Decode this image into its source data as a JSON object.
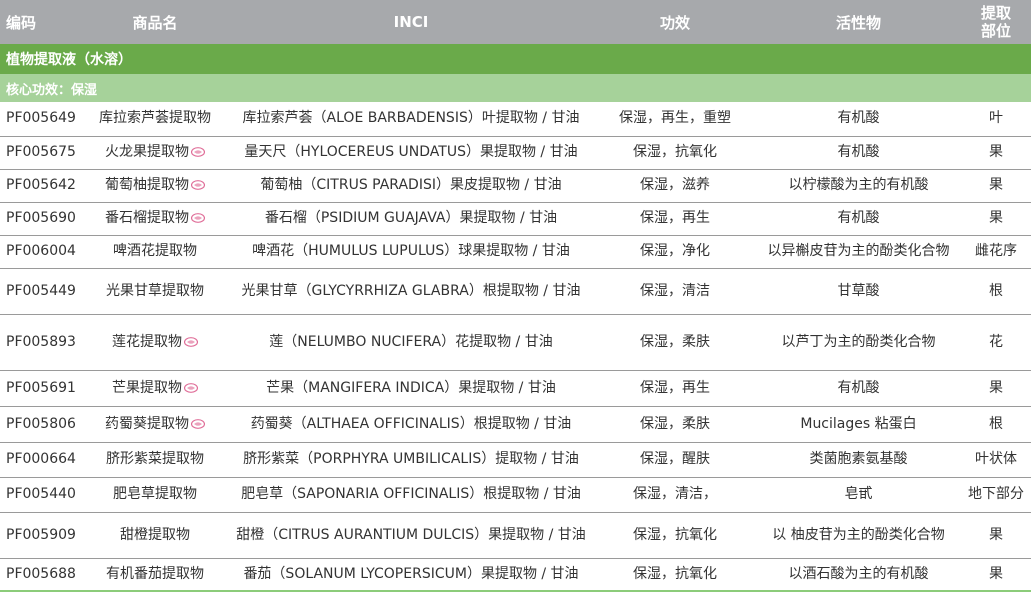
{
  "table": {
    "headers": [
      "编码",
      "商品名",
      "INCI",
      "功效",
      "活性物",
      "提取\n部位"
    ],
    "group_title": "植物提取液（水溶）",
    "subgroup_title": "核心功效：保湿",
    "rows": [
      {
        "code": "PF005649",
        "name": "库拉索芦荟提取物",
        "badge": false,
        "inci": "库拉索芦荟（ALOE BARBADENSIS）叶提取物 / 甘油",
        "effect": "保湿，再生，重塑",
        "active": "有机酸",
        "part": "叶"
      },
      {
        "code": "PF005675",
        "name": "火龙果提取物",
        "badge": true,
        "inci": "量天尺（HYLOCEREUS UNDATUS）果提取物 / 甘油",
        "effect": "保湿，抗氧化",
        "active": "有机酸",
        "part": "果"
      },
      {
        "code": "PF005642",
        "name": "葡萄柚提取物",
        "badge": true,
        "inci": "葡萄柚（CITRUS PARADISI）果皮提取物 / 甘油",
        "effect": "保湿，滋养",
        "active": "以柠檬酸为主的有机酸",
        "part": "果"
      },
      {
        "code": "PF005690",
        "name": "番石榴提取物",
        "badge": true,
        "inci": "番石榴（PSIDIUM GUAJAVA）果提取物 / 甘油",
        "effect": "保湿，再生",
        "active": "有机酸",
        "part": "果"
      },
      {
        "code": "PF006004",
        "name": "啤酒花提取物",
        "badge": false,
        "inci": "啤酒花（HUMULUS LUPULUS）球果提取物 / 甘油",
        "effect": "保湿，净化",
        "active": "以异槲皮苷为主的酚类化合物",
        "part": "雌花序"
      },
      {
        "code": "PF005449",
        "name": "光果甘草提取物",
        "badge": false,
        "inci": "光果甘草（GLYCYRRHIZA GLABRA）根提取物 / 甘油",
        "effect": "保湿，清洁",
        "active": "甘草酸",
        "part": "根"
      },
      {
        "code": "PF005893",
        "name": "莲花提取物",
        "badge": true,
        "inci": "莲（NELUMBO NUCIFERA）花提取物 / 甘油",
        "effect": "保湿，柔肤",
        "active": "以芦丁为主的酚类化合物",
        "part": "花"
      },
      {
        "code": "PF005691",
        "name": "芒果提取物",
        "badge": true,
        "inci": "芒果（MANGIFERA INDICA）果提取物 / 甘油",
        "effect": "保湿，再生",
        "active": "有机酸",
        "part": "果"
      },
      {
        "code": "PF005806",
        "name": "药蜀葵提取物",
        "badge": true,
        "inci": "药蜀葵（ALTHAEA OFFICINALIS）根提取物 / 甘油",
        "effect": "保湿，柔肤",
        "active": "Mucilages 粘蛋白",
        "part": "根"
      },
      {
        "code": "PF000664",
        "name": "脐形紫菜提取物",
        "badge": false,
        "inci": "脐形紫菜（PORPHYRA UMBILICALIS）提取物 / 甘油",
        "effect": "保湿，醒肤",
        "active": "类菌胞素氨基酸",
        "part": "叶状体"
      },
      {
        "code": "PF005440",
        "name": "肥皂草提取物",
        "badge": false,
        "inci": "肥皂草（SAPONARIA OFFICINALIS）根提取物 / 甘油",
        "effect": "保湿，清洁，",
        "active": "皂甙",
        "part": "地下部分"
      },
      {
        "code": "PF005909",
        "name": "甜橙提取物",
        "badge": false,
        "inci": "甜橙（CITRUS AURANTIUM DULCIS）果提取物 / 甘油",
        "effect": "保湿，抗氧化",
        "active": "以 柚皮苷为主的酚类化合物",
        "part": "果"
      },
      {
        "code": "PF005688",
        "name": "有机番茄提取物",
        "badge": false,
        "inci": "番茄（SOLANUM LYCOPERSICUM）果提取物 / 甘油",
        "effect": "保湿，抗氧化",
        "active": "以酒石酸为主的有机酸",
        "part": "果"
      }
    ]
  },
  "colors": {
    "header_bg": "#a7a9ac",
    "group_bg": "#6aaa4a",
    "subgroup_bg": "#a6d29a",
    "badge": "#e0709a"
  }
}
